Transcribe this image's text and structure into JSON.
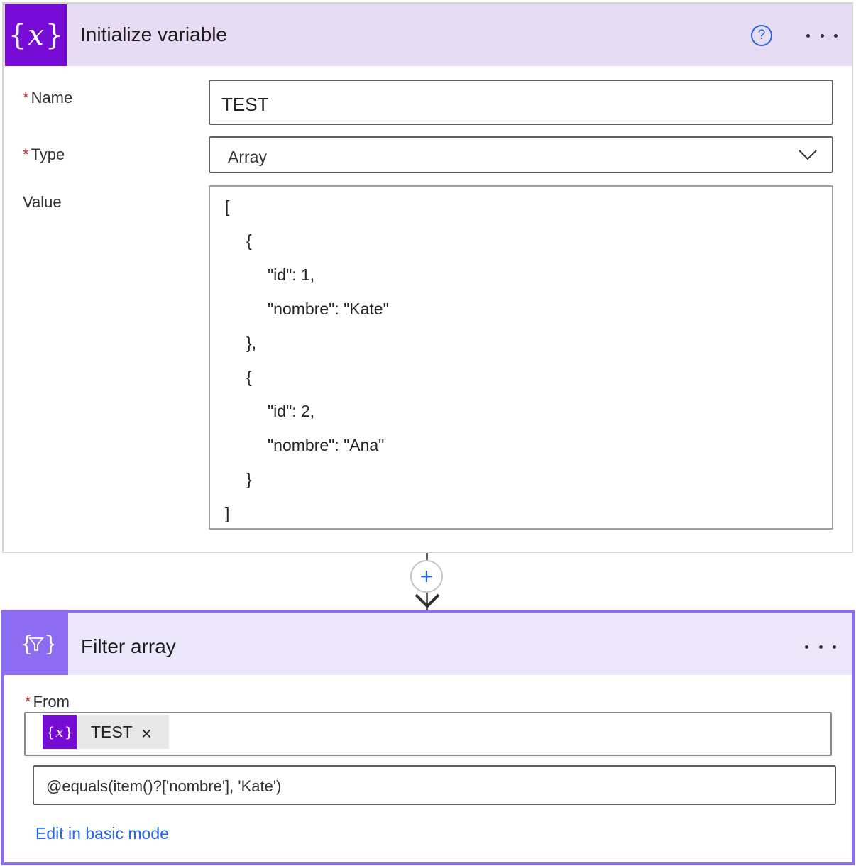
{
  "init_variable": {
    "title": "Initialize variable",
    "icon": "variable-braces-icon",
    "name_label": "Name",
    "name_value": "TEST",
    "type_label": "Type",
    "type_value": "Array",
    "value_label": "Value",
    "value_lines": [
      "[",
      "{",
      "\"id\": 1,",
      "\"nombre\": \"Kate\"",
      "},",
      "{",
      "\"id\": 2,",
      "\"nombre\": \"Ana\"",
      "}",
      "]"
    ]
  },
  "connector": {
    "icon": "plus-icon"
  },
  "filter_array": {
    "title": "Filter array",
    "icon": "filter-braces-icon",
    "from_label": "From",
    "from_token": "TEST",
    "expression": "@equals(item()?['nombre'], 'Kate')",
    "edit_link": "Edit in basic mode"
  },
  "colors": {
    "variable_accent": "#770bd6",
    "filter_accent": "#8c6cf0",
    "link": "#2266e3",
    "required": "#a4262c"
  }
}
